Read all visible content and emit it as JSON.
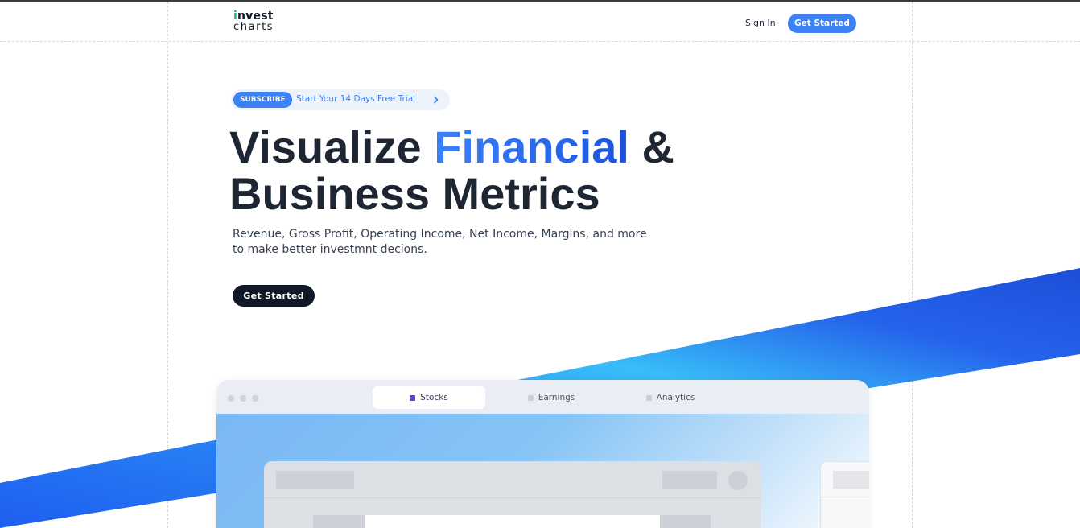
{
  "header": {
    "logo_top": "invest",
    "logo_bottom": "charts",
    "sign_in": "Sign In",
    "get_started": "Get Started"
  },
  "hero": {
    "badge": "SUBSCRIBE",
    "trial_text": "Start Your 14 Days Free Trial",
    "title_part1": "Visualize ",
    "title_accent": "Financial",
    "title_part2": " &",
    "title_line2": "Business Metrics",
    "subtitle": "Revenue, Gross Profit, Operating Income, Net Income, Margins, and more to make better investmnt decions.",
    "cta": "Get Started"
  },
  "preview": {
    "tabs": [
      {
        "label": "Stocks",
        "active": true
      },
      {
        "label": "Earnings",
        "active": false
      },
      {
        "label": "Analytics",
        "active": false
      }
    ]
  },
  "colors": {
    "primary": "#3b82f6",
    "dark": "#111827",
    "accent_green": "#10b981",
    "band_start": "#1d4ed8",
    "band_end": "#38bdf8"
  },
  "icons": {
    "chevron": "chevron-right-icon",
    "window_dots": "window-control-dots"
  }
}
